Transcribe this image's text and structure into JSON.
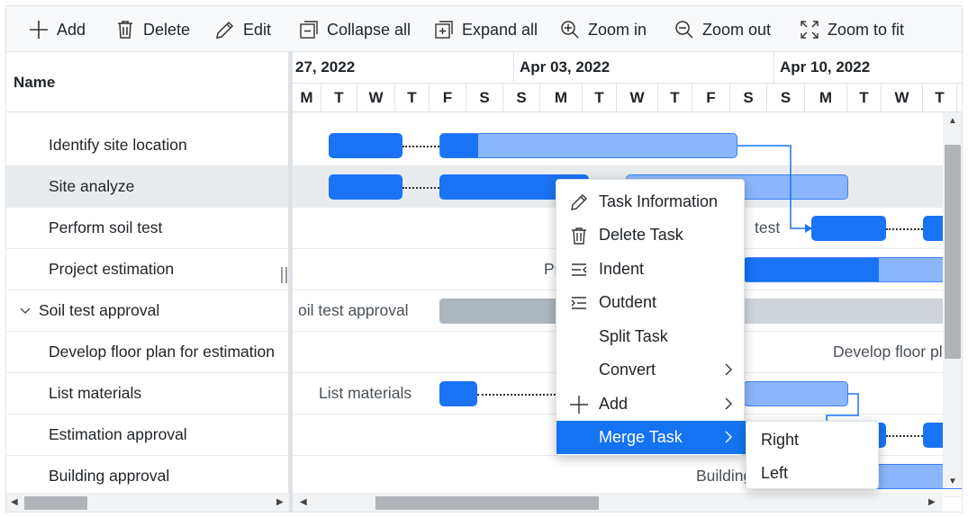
{
  "toolbar": {
    "items": [
      {
        "id": "add",
        "label": "Add",
        "icon": "plus-icon"
      },
      {
        "id": "delete",
        "label": "Delete",
        "icon": "trash-icon"
      },
      {
        "id": "edit",
        "label": "Edit",
        "icon": "pencil-icon"
      },
      {
        "id": "collapse",
        "label": "Collapse all",
        "icon": "collapse-icon"
      },
      {
        "id": "expand",
        "label": "Expand all",
        "icon": "expand-icon"
      },
      {
        "id": "zoomin",
        "label": "Zoom in",
        "icon": "zoom-in-icon"
      },
      {
        "id": "zoomout",
        "label": "Zoom out",
        "icon": "zoom-out-icon"
      },
      {
        "id": "zoomfit",
        "label": "Zoom to fit",
        "icon": "fit-icon"
      }
    ]
  },
  "grid": {
    "header": "Name",
    "rows": [
      {
        "label": "Identify site location"
      },
      {
        "label": "Site analyze",
        "selected": true
      },
      {
        "label": "Perform soil test"
      },
      {
        "label": "Project estimation"
      },
      {
        "label": "Soil test approval",
        "parent": true
      },
      {
        "label": "Develop floor plan for estimation"
      },
      {
        "label": "List materials"
      },
      {
        "label": "Estimation approval"
      },
      {
        "label": "Building approval"
      }
    ]
  },
  "timeline": {
    "weeks": [
      "27, 2022",
      "Apr 03, 2022",
      "Apr 10, 2022"
    ],
    "days": [
      "M",
      "T",
      "W",
      "T",
      "F",
      "S",
      "S",
      "M",
      "T",
      "W",
      "T",
      "F",
      "S",
      "S",
      "M",
      "T",
      "W",
      "T"
    ]
  },
  "chart_labels": {
    "perform_soil_test": "test",
    "project_estimation": "Pro",
    "soil_test_approval": "oil test approval",
    "develop_floor_plan": "Develop floor pla",
    "list_materials": "List materials",
    "building_approval": "Building"
  },
  "context_menu": {
    "items": [
      {
        "label": "Task Information",
        "icon": "pencil-icon"
      },
      {
        "label": "Delete Task",
        "icon": "trash-icon"
      },
      {
        "label": "Indent",
        "icon": "indent-icon"
      },
      {
        "label": "Outdent",
        "icon": "outdent-icon"
      },
      {
        "label": "Split Task"
      },
      {
        "label": "Convert",
        "submenu": true
      },
      {
        "label": "Add",
        "icon": "plus-icon",
        "submenu": true
      },
      {
        "label": "Merge Task",
        "submenu": true,
        "active": true
      }
    ],
    "merge_submenu": [
      "Right",
      "Left"
    ]
  },
  "colors": {
    "accent": "#1473f0",
    "bar_dark": "#1a73f5",
    "bar_light": "#8ab6fb",
    "summary_grey": "#adb5bd"
  }
}
